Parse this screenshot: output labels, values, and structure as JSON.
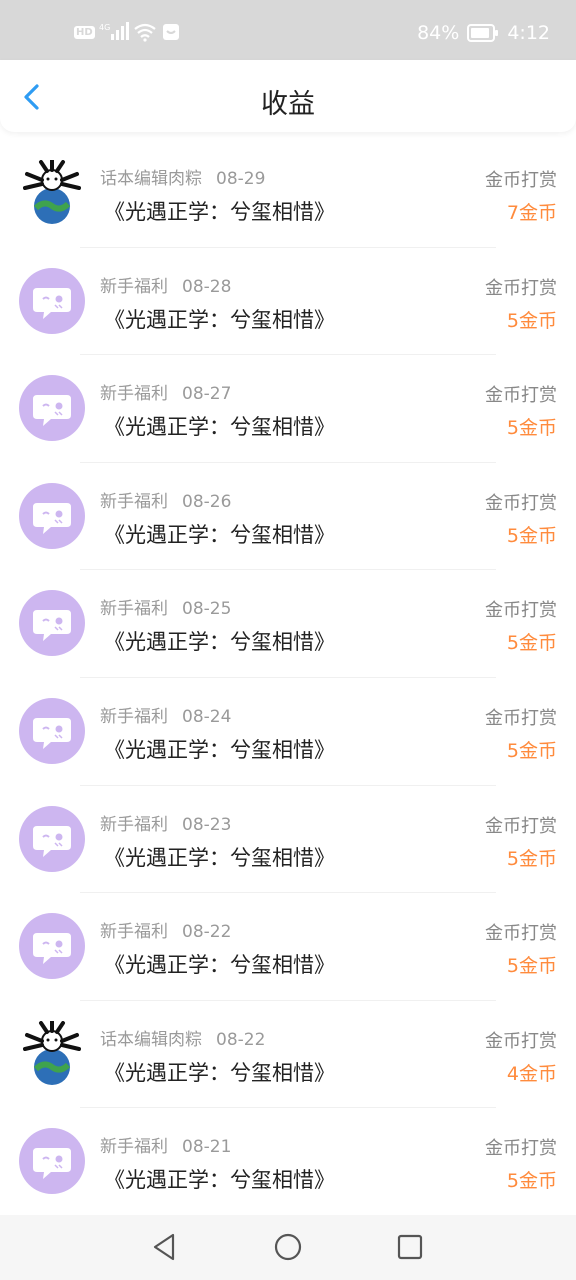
{
  "statusbar": {
    "network": "4G",
    "battery": "84%",
    "time": "4:12"
  },
  "header": {
    "title": "收益"
  },
  "colors": {
    "accent": "#2e9cf3",
    "amount": "#ff8b3d",
    "avatar_purple": "#cdb6f0"
  },
  "rows": [
    {
      "avatar": "robot-avatar",
      "source": "话本编辑肉粽",
      "date": "08-29",
      "book": "《光遇正学：兮玺相惜》",
      "type": "金币打赏",
      "amount": "7金币"
    },
    {
      "avatar": "chat-bubble-avatar",
      "source": "新手福利",
      "date": "08-28",
      "book": "《光遇正学：兮玺相惜》",
      "type": "金币打赏",
      "amount": "5金币"
    },
    {
      "avatar": "chat-bubble-avatar",
      "source": "新手福利",
      "date": "08-27",
      "book": "《光遇正学：兮玺相惜》",
      "type": "金币打赏",
      "amount": "5金币"
    },
    {
      "avatar": "chat-bubble-avatar",
      "source": "新手福利",
      "date": "08-26",
      "book": "《光遇正学：兮玺相惜》",
      "type": "金币打赏",
      "amount": "5金币"
    },
    {
      "avatar": "chat-bubble-avatar",
      "source": "新手福利",
      "date": "08-25",
      "book": "《光遇正学：兮玺相惜》",
      "type": "金币打赏",
      "amount": "5金币"
    },
    {
      "avatar": "chat-bubble-avatar",
      "source": "新手福利",
      "date": "08-24",
      "book": "《光遇正学：兮玺相惜》",
      "type": "金币打赏",
      "amount": "5金币"
    },
    {
      "avatar": "chat-bubble-avatar",
      "source": "新手福利",
      "date": "08-23",
      "book": "《光遇正学：兮玺相惜》",
      "type": "金币打赏",
      "amount": "5金币"
    },
    {
      "avatar": "chat-bubble-avatar",
      "source": "新手福利",
      "date": "08-22",
      "book": "《光遇正学：兮玺相惜》",
      "type": "金币打赏",
      "amount": "5金币"
    },
    {
      "avatar": "robot-avatar",
      "source": "话本编辑肉粽",
      "date": "08-22",
      "book": "《光遇正学：兮玺相惜》",
      "type": "金币打赏",
      "amount": "4金币"
    },
    {
      "avatar": "chat-bubble-avatar",
      "source": "新手福利",
      "date": "08-21",
      "book": "《光遇正学：兮玺相惜》",
      "type": "金币打赏",
      "amount": "5金币"
    }
  ]
}
